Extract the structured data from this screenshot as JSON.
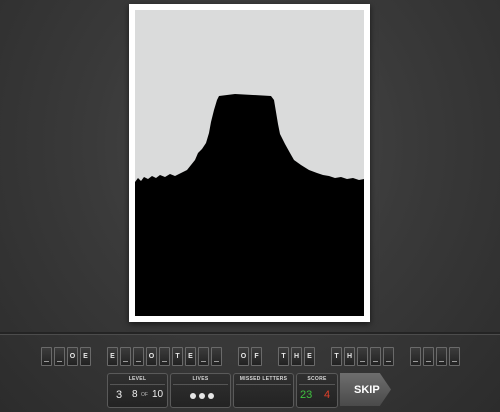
{
  "puzzle": {
    "words": [
      [
        "",
        "",
        "O",
        "E"
      ],
      [
        "E",
        "",
        "",
        "O",
        "",
        "T",
        "E",
        "",
        ""
      ],
      [
        "O",
        "F"
      ],
      [
        "T",
        "H",
        "E"
      ],
      [
        "T",
        "H",
        "",
        "",
        ""
      ],
      [
        "",
        "",
        "",
        ""
      ]
    ]
  },
  "status": {
    "level_caption": "LEVEL",
    "level_value": "3",
    "progress_current": "8",
    "progress_of": "OF",
    "progress_total": "10",
    "lives_caption": "LIVES",
    "lives_remaining": 3,
    "missed_caption": "MISSED LETTERS",
    "missed_letters": "",
    "score_caption": "SCORE",
    "score_correct": "23",
    "score_wrong": "4",
    "skip_label": "SKIP"
  },
  "colors": {
    "score_correct": "#3fc13f",
    "score_wrong": "#e0402a"
  }
}
